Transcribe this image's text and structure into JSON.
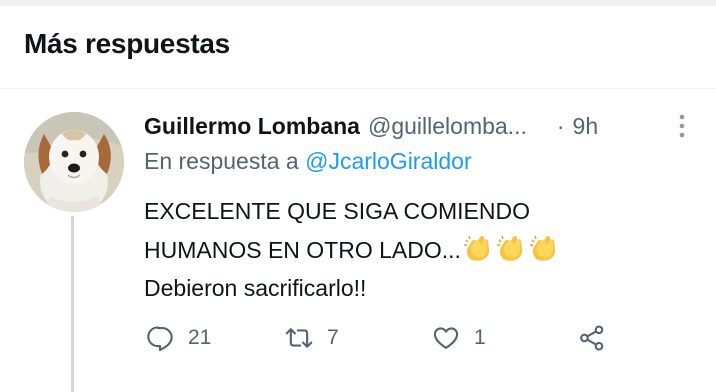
{
  "section": {
    "title": "Más respuestas"
  },
  "tweet": {
    "author_name": "Guillermo Lombana",
    "author_handle": "@guillelomba...",
    "separator": "·",
    "time": "9h",
    "reply_prefix": "En respuesta a",
    "reply_to": "@JcarloGiraldor",
    "body_line_1": "EXCELENTE QUE SIGA COMIENDO",
    "body_line_2": "HUMANOS EN OTRO LADO...",
    "body_line_3": "Debieron sacrificarlo!!",
    "emoji": [
      "clapping-hands",
      "clapping-hands",
      "clapping-hands"
    ],
    "avatar_subject": "white dog with brown ears",
    "more_icon": "vertical-dots-icon"
  },
  "actions": {
    "reply": {
      "icon": "reply-icon",
      "count": "21"
    },
    "retweet": {
      "icon": "retweet-icon",
      "count": "7"
    },
    "like": {
      "icon": "heart-icon",
      "count": "1"
    },
    "share": {
      "icon": "share-icon"
    }
  },
  "colors": {
    "text": "#0f1419",
    "secondary": "#536471",
    "link": "#1d9bf0",
    "divider": "#eff3f4",
    "thread_line": "#cfd9de"
  }
}
